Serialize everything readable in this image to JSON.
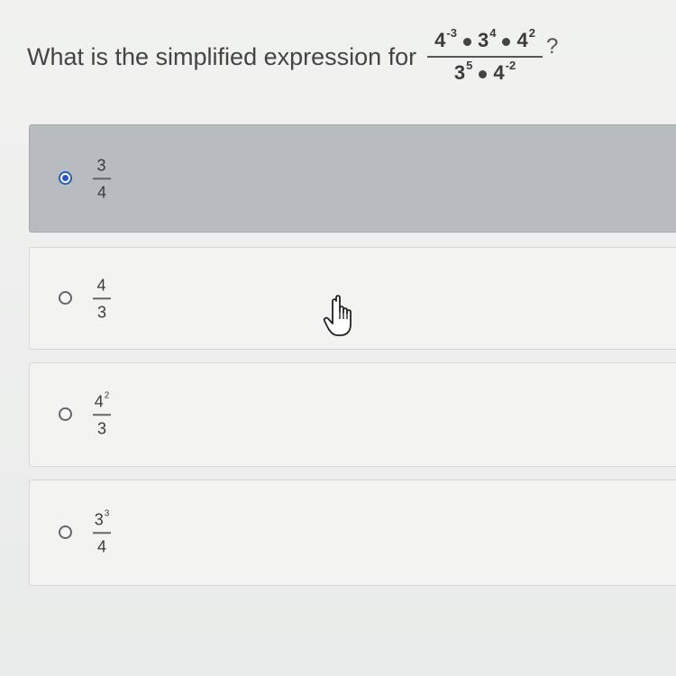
{
  "question": {
    "text": "What is the simplified expression for",
    "numerator": [
      {
        "base": "4",
        "exp": "-3"
      },
      {
        "base": "3",
        "exp": "4"
      },
      {
        "base": "4",
        "exp": "2"
      }
    ],
    "denominator": [
      {
        "base": "3",
        "exp": "5"
      },
      {
        "base": "4",
        "exp": "-2"
      }
    ],
    "end_mark": "?"
  },
  "options": [
    {
      "numerator": "3",
      "num_exp": "",
      "denominator": "4",
      "selected": true
    },
    {
      "numerator": "4",
      "num_exp": "",
      "denominator": "3",
      "selected": false
    },
    {
      "numerator": "4",
      "num_exp": "2",
      "denominator": "3",
      "selected": false
    },
    {
      "numerator": "3",
      "num_exp": "3",
      "denominator": "4",
      "selected": false
    }
  ],
  "icons": {
    "cursor": "hand-pointer-icon",
    "radio_selected": "radio-selected-icon",
    "radio_unselected": "radio-unselected-icon"
  },
  "colors": {
    "selected_background": "#b7bcc0",
    "radio_accent": "#2a55c9"
  }
}
